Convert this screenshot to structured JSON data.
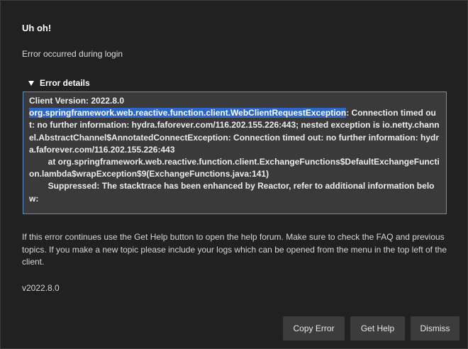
{
  "dialog": {
    "title": "Uh oh!",
    "message": "Error occurred during login",
    "details_label": "Error details",
    "details": {
      "line1": "Client Version: 2022.8.0",
      "selected": "org.springframework.web.reactive.function.client.WebClientRequestException",
      "rest": ": Connection timed out: no further information: hydra.faforever.com/116.202.155.226:443; nested exception is io.netty.channel.AbstractChannel$AnnotatedConnectException: Connection timed out: no further information: hydra.faforever.com/116.202.155.226:443\n        at org.springframework.web.reactive.function.client.ExchangeFunctions$DefaultExchangeFunction.lambda$wrapException$9(ExchangeFunctions.java:141)\n        Suppressed: The stacktrace has been enhanced by Reactor, refer to additional information below:"
    },
    "help_text": "If this error continues use the Get Help button to open the help forum. Make sure to check the FAQ and previous topics. If you make a new topic please include your logs which can be opened from the menu in the top left of the client.",
    "version": "v2022.8.0",
    "buttons": {
      "copy_error": "Copy Error",
      "get_help": "Get Help",
      "dismiss": "Dismiss"
    }
  }
}
